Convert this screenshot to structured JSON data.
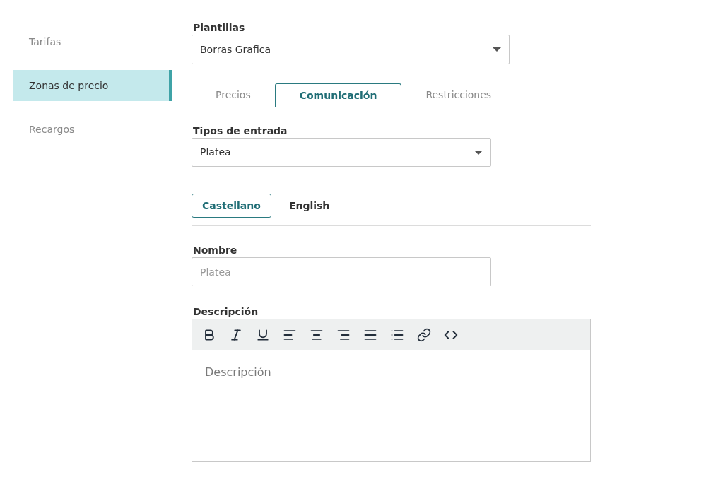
{
  "sidebar": {
    "items": [
      {
        "label": "Tarifas",
        "selected": false
      },
      {
        "label": "Zonas de precio",
        "selected": true
      },
      {
        "label": "Recargos",
        "selected": false
      }
    ]
  },
  "template": {
    "label": "Plantillas",
    "value": "Borras Grafica"
  },
  "tabs": [
    {
      "label": "Precios",
      "selected": false
    },
    {
      "label": "Comunicación",
      "selected": true
    },
    {
      "label": "Restricciones",
      "selected": false
    }
  ],
  "ticket_type": {
    "label": "Tipos de entrada",
    "value": "Platea"
  },
  "languages": [
    {
      "label": "Castellano",
      "selected": true
    },
    {
      "label": "English",
      "selected": false
    }
  ],
  "name": {
    "label": "Nombre",
    "placeholder": "Platea"
  },
  "description": {
    "label": "Descripción",
    "placeholder": "Descripción"
  }
}
